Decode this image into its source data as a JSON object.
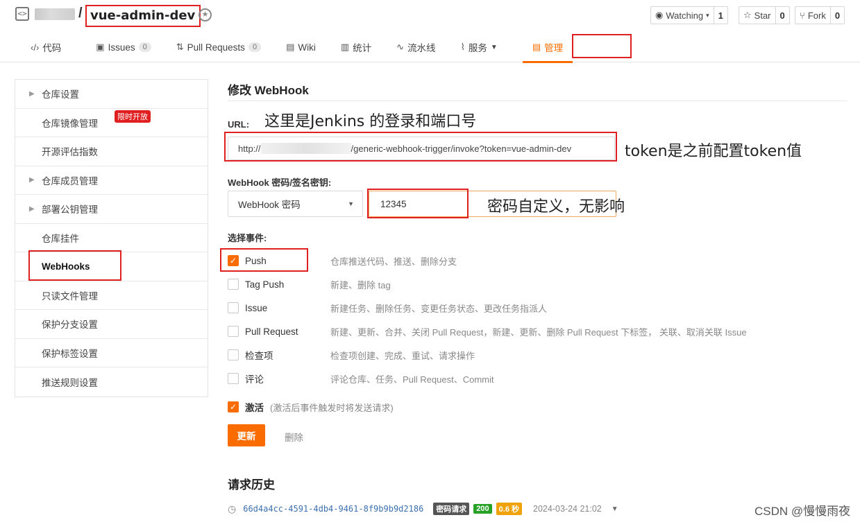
{
  "repo": {
    "name": "vue-admin-dev",
    "slash": "/",
    "watch": {
      "label": "Watching",
      "count": "1"
    },
    "star": {
      "label": "Star",
      "count": "0"
    },
    "fork": {
      "label": "Fork",
      "count": "0"
    }
  },
  "tabs": [
    {
      "label": "代码",
      "icon": "code-icon"
    },
    {
      "label": "Issues",
      "count": "0",
      "icon": "issues-icon"
    },
    {
      "label": "Pull Requests",
      "count": "0",
      "icon": "pull-request-icon"
    },
    {
      "label": "Wiki",
      "icon": "wiki-icon"
    },
    {
      "label": "统计",
      "icon": "chart-icon"
    },
    {
      "label": "流水线",
      "icon": "pipeline-icon"
    },
    {
      "label": "服务",
      "icon": "pulse-icon"
    },
    {
      "label": "管理",
      "icon": "manage-icon"
    }
  ],
  "sidebar": {
    "items": [
      {
        "label": "仓库设置"
      },
      {
        "label": "仓库镜像管理",
        "tag": "限时开放"
      },
      {
        "label": "开源评估指数"
      },
      {
        "label": "仓库成员管理"
      },
      {
        "label": "部署公钥管理"
      },
      {
        "label": "仓库挂件"
      },
      {
        "label": "WebHooks"
      },
      {
        "label": "只读文件管理"
      },
      {
        "label": "保护分支设置"
      },
      {
        "label": "保护标签设置"
      },
      {
        "label": "推送规则设置"
      }
    ]
  },
  "main": {
    "title": "修改 WebHook",
    "url_label": "URL:",
    "url_prefix": "http://",
    "url_suffix": "/generic-webhook-trigger/invoke?token=vue-admin-dev",
    "secret_label": "WebHook 密码/签名密钥:",
    "secret_type": "WebHook 密码",
    "secret_value": "12345",
    "events_label": "选择事件:",
    "events": [
      {
        "name": "Push",
        "desc": "仓库推送代码、推送、删除分支",
        "checked": true
      },
      {
        "name": "Tag Push",
        "desc": "新建、删除 tag",
        "checked": false
      },
      {
        "name": "Issue",
        "desc": "新建任务、删除任务、变更任务状态、更改任务指派人",
        "checked": false
      },
      {
        "name": "Pull Request",
        "desc": "新建、更新、合并、关闭 Pull Request，新建、更新、删除 Pull Request 下标签， 关联、取消关联 Issue",
        "checked": false
      },
      {
        "name": "检查项",
        "desc": "检查项创建、完成、重试、请求操作",
        "checked": false
      },
      {
        "name": "评论",
        "desc": "评论仓库、任务、Pull Request、Commit",
        "checked": false
      }
    ],
    "active_label": "激活",
    "active_hint": "(激活后事件触发时将发送请求)",
    "active_checked": true,
    "update_button": "更新",
    "delete_button": "删除"
  },
  "annotations": {
    "url_note": "这里是Jenkins 的登录和端口号",
    "token_note": "token是之前配置token值",
    "password_note": "密码自定义，无影响"
  },
  "history": {
    "title": "请求历史",
    "rows": [
      {
        "id": "66d4a4cc-4591-4db4-9461-8f9b9b9d2186",
        "type": "密码请求",
        "status": "200",
        "duration": "0.6 秒",
        "time": "2024-03-24 21:02"
      }
    ]
  },
  "watermark": "CSDN @慢慢雨夜",
  "colors": {
    "accent": "#fa6c00",
    "highlight": "#e02020",
    "success": "#27a227"
  }
}
